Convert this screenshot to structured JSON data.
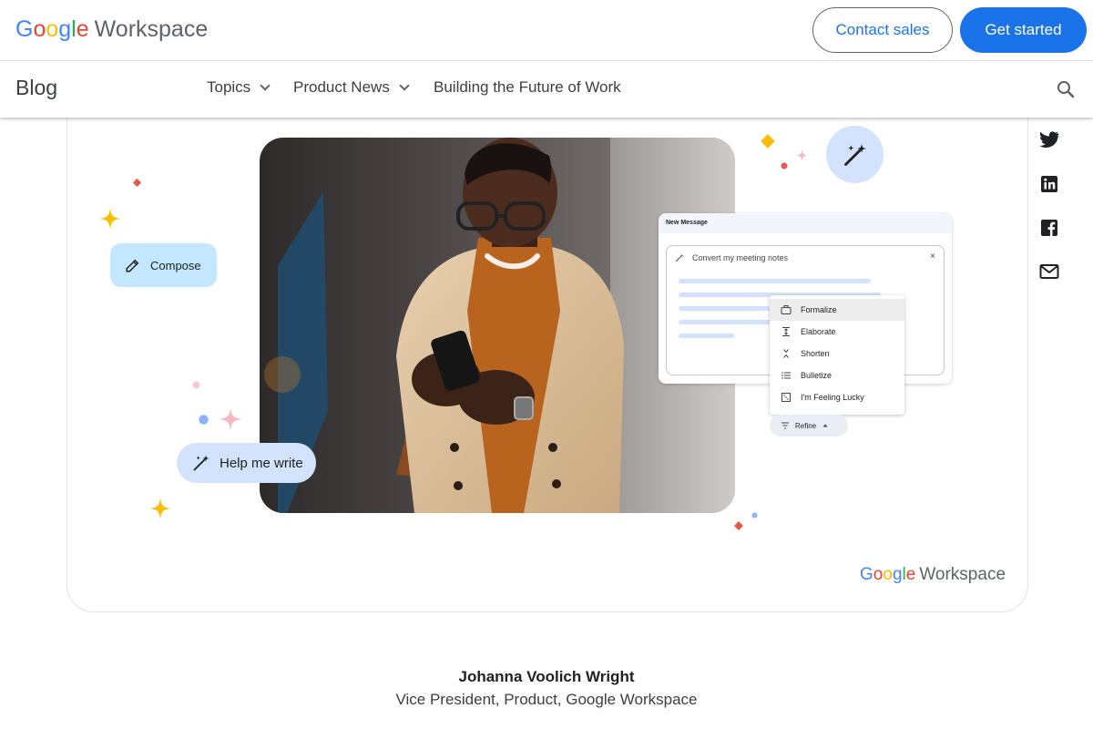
{
  "header": {
    "brand": {
      "g1": "G",
      "g2": "o",
      "g3": "o",
      "g4": "g",
      "g5": "l",
      "g6": "e",
      "product": "Workspace"
    },
    "contact_label": "Contact sales",
    "start_label": "Get started"
  },
  "nav": {
    "section": "Blog",
    "items": [
      {
        "label": "Topics"
      },
      {
        "label": "Product News"
      },
      {
        "label": "Building the Future of Work"
      }
    ]
  },
  "hero": {
    "compose_chip": "Compose",
    "help_chip": "Help me write",
    "compose_window": {
      "title": "New Message",
      "prompt": "Convert my meeting notes",
      "close": "×"
    },
    "refine_menu": [
      {
        "label": "Formalize",
        "icon": "briefcase-icon"
      },
      {
        "label": "Elaborate",
        "icon": "expand-icon"
      },
      {
        "label": "Shorten",
        "icon": "collapse-icon"
      },
      {
        "label": "Bulletize",
        "icon": "list-icon"
      },
      {
        "label": "I'm Feeling Lucky",
        "icon": "dice-icon"
      }
    ],
    "refine_chip": "Refine",
    "brand": {
      "g1": "G",
      "g2": "o",
      "g3": "o",
      "g4": "g",
      "g5": "l",
      "g6": "e",
      "product": "Workspace"
    }
  },
  "social": [
    "twitter-icon",
    "linkedin-icon",
    "facebook-icon",
    "mail-icon"
  ],
  "author": {
    "name": "Johanna Voolich Wright",
    "title": "Vice President, Product, Google Workspace"
  },
  "colors": {
    "accent": "#1a73e8",
    "chip_blue": "#c2e7ff",
    "chip_lavender": "#d3e3fd"
  }
}
